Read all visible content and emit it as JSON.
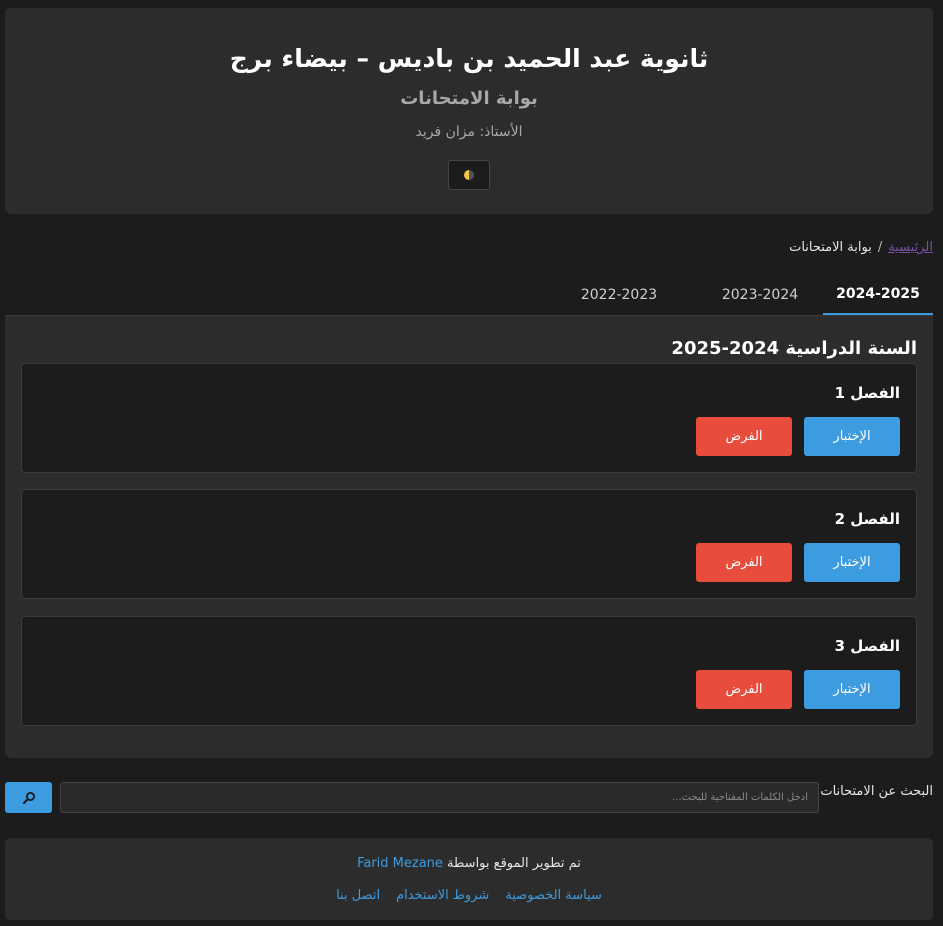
{
  "header": {
    "school_name": "ثانوية عبد الحميد بن باديس – بيضاء برج",
    "portal_title": "بوابة الامتحانات",
    "teacher": "الأستاذ: مزان فريد"
  },
  "breadcrumb": {
    "home": "الرئيسية",
    "separator": "/",
    "current": "بوابة الامتحانات"
  },
  "tabs": [
    {
      "label": "2024-2025",
      "active": true
    },
    {
      "label": "2023-2024",
      "active": false
    },
    {
      "label": "2022-2023",
      "active": false
    }
  ],
  "content": {
    "year_title": "السنة الدراسية 2024-2025",
    "terms": [
      {
        "title": "الفصل 1",
        "exam_label": "الإختبار",
        "test_label": "الفرض"
      },
      {
        "title": "الفصل 2",
        "exam_label": "الإختبار",
        "test_label": "الفرض"
      },
      {
        "title": "الفصل 3",
        "exam_label": "الإختبار",
        "test_label": "الفرض"
      }
    ]
  },
  "search": {
    "label": "البحث عن الامتحانات",
    "placeholder": "ادخل الكلمات المفتاحية للبحث...",
    "button_icon": "search-icon"
  },
  "footer": {
    "credit_prefix": "تم تطوير الموقع بواسطة",
    "credit_name": "Farid Mezane",
    "links": [
      "سياسة الخصوصية",
      "شروط الاستخدام",
      "اتصل بنا"
    ]
  },
  "colors": {
    "background": "#1c1c1c",
    "panel": "#2c2c2c",
    "accent_blue": "#3d9be0",
    "accent_red": "#e74c3c"
  }
}
